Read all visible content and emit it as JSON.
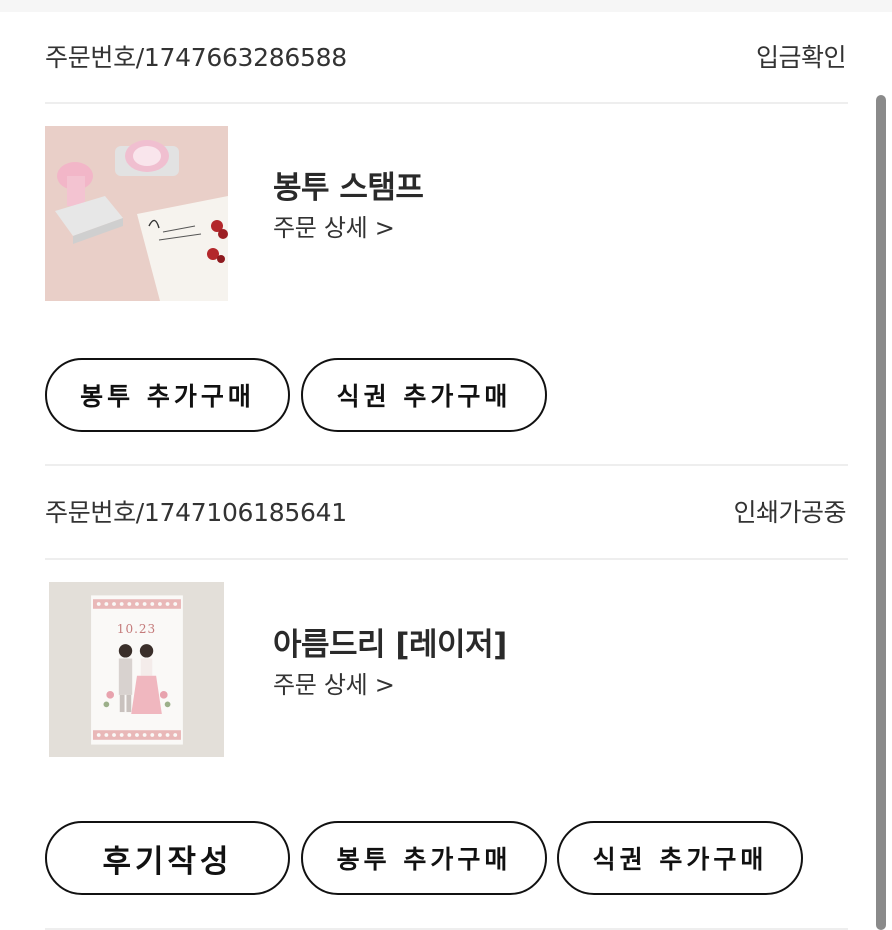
{
  "orders": [
    {
      "order_number": "주문번호/1747663286588",
      "status": "입금확인",
      "product": {
        "name": "봉투 스탬프",
        "detail_link": "주문 상세 >"
      },
      "actions": [
        {
          "label": "봉투 추가구매"
        },
        {
          "label": "식권 추가구매"
        }
      ]
    },
    {
      "order_number": "주문번호/1747106185641",
      "status": "인쇄가공중",
      "product": {
        "name": "아름드리 [레이저]",
        "detail_link": "주문 상세 >",
        "card_text": "10.23"
      },
      "actions": [
        {
          "label": "후기작성"
        },
        {
          "label": "봉투 추가구매"
        },
        {
          "label": "식권 추가구매"
        }
      ]
    }
  ]
}
